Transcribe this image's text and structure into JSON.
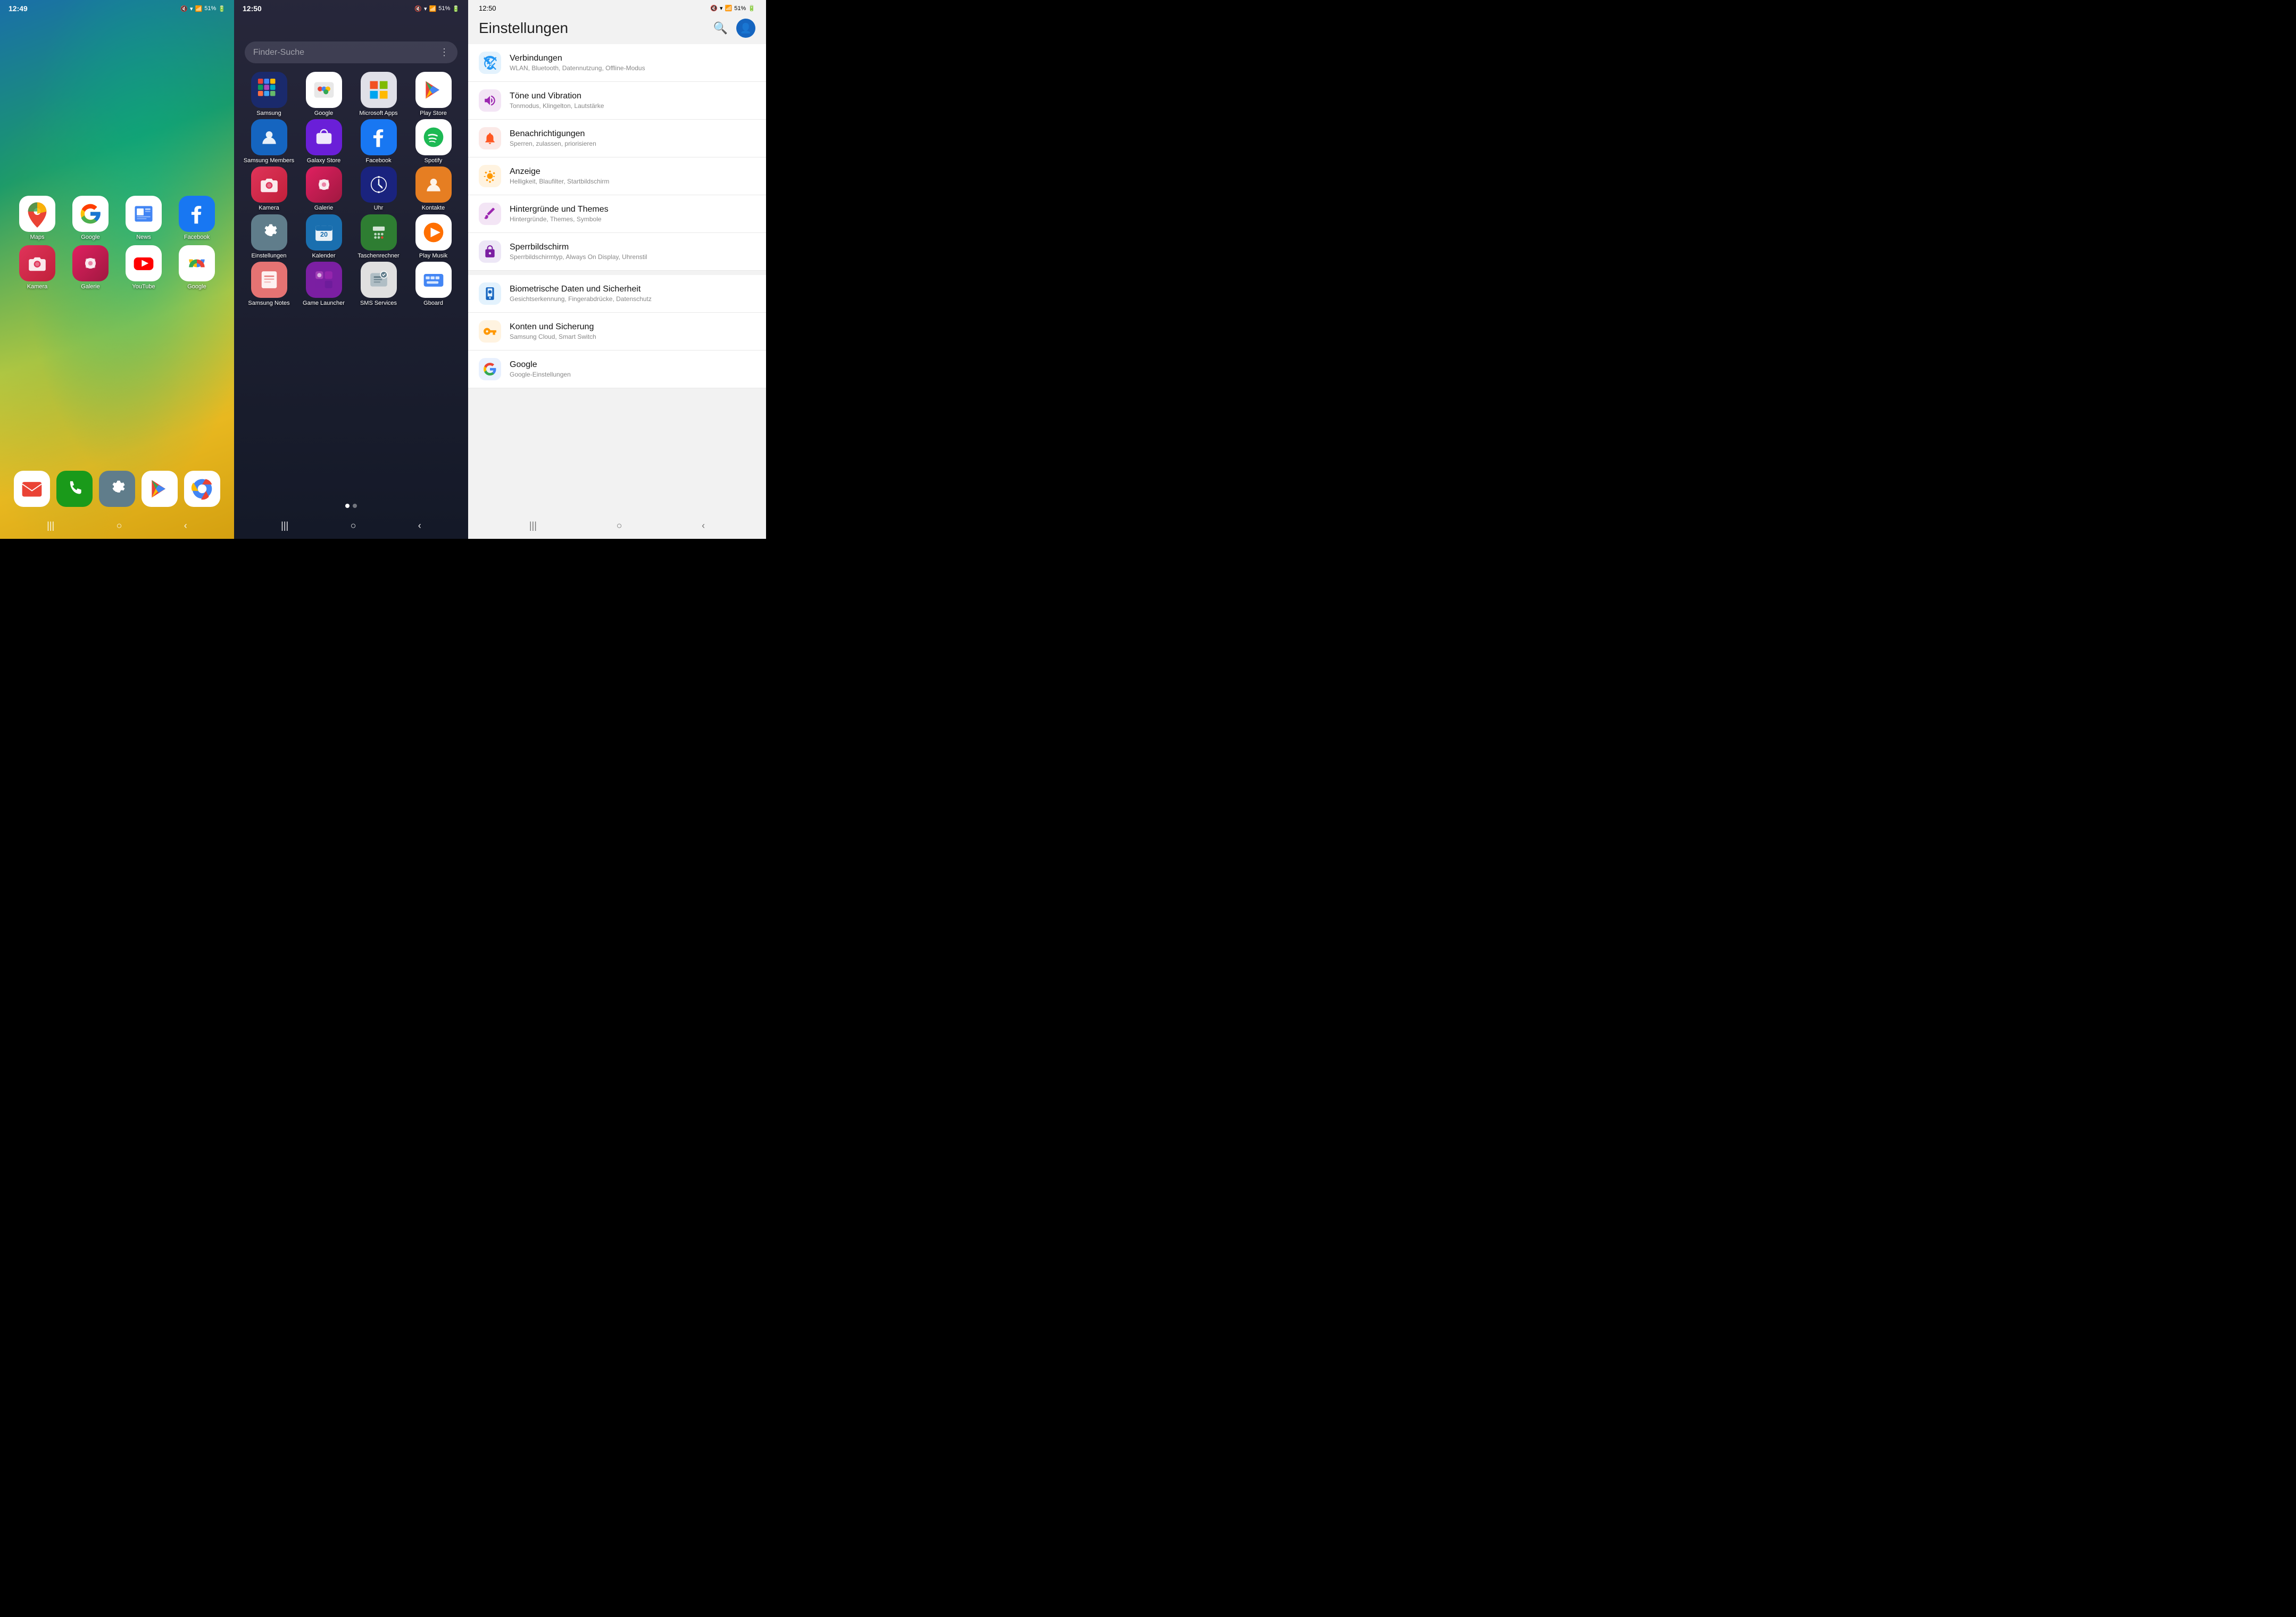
{
  "panel1": {
    "time": "12:49",
    "status": "51%",
    "apps_row1": [
      {
        "id": "maps",
        "label": "Maps",
        "icon": "maps"
      },
      {
        "id": "google",
        "label": "Google",
        "icon": "google"
      },
      {
        "id": "news",
        "label": "News",
        "icon": "news"
      },
      {
        "id": "facebook",
        "label": "Facebook",
        "icon": "facebook-home"
      }
    ],
    "apps_row2": [
      {
        "id": "kamera",
        "label": "Kamera",
        "icon": "kamera"
      },
      {
        "id": "galerie",
        "label": "Galerie",
        "icon": "galerie"
      },
      {
        "id": "youtube",
        "label": "YouTube",
        "icon": "youtube"
      },
      {
        "id": "google-photos",
        "label": "Google",
        "icon": "google-photos"
      }
    ],
    "dock": [
      {
        "id": "mail",
        "label": "",
        "icon": "mail"
      },
      {
        "id": "phone",
        "label": "",
        "icon": "phone"
      },
      {
        "id": "settings-dock",
        "label": "",
        "icon": "einstellungen-dock"
      },
      {
        "id": "playstore-dock",
        "label": "",
        "icon": "playstore-dock"
      },
      {
        "id": "chrome",
        "label": "",
        "icon": "chrome"
      }
    ],
    "nav": [
      "|||",
      "○",
      "‹"
    ]
  },
  "panel2": {
    "time": "12:50",
    "status": "51%",
    "search_placeholder": "Finder-Suche",
    "apps": [
      {
        "id": "samsung",
        "label": "Samsung",
        "icon": "samsung"
      },
      {
        "id": "google-folder",
        "label": "Google",
        "icon": "google-folder"
      },
      {
        "id": "ms-apps",
        "label": "Microsoft Apps",
        "icon": "ms-apps"
      },
      {
        "id": "playstore",
        "label": "Play Store",
        "icon": "playstore"
      },
      {
        "id": "samsung-members",
        "label": "Samsung Members",
        "icon": "samsung-members"
      },
      {
        "id": "galaxy-store",
        "label": "Galaxy Store",
        "icon": "galaxy-store"
      },
      {
        "id": "facebook-drawer",
        "label": "Facebook",
        "icon": "facebook-drawer"
      },
      {
        "id": "spotify",
        "label": "Spotify",
        "icon": "spotify"
      },
      {
        "id": "kamera-drawer",
        "label": "Kamera",
        "icon": "kamera-drawer"
      },
      {
        "id": "galerie-drawer",
        "label": "Galerie",
        "icon": "galerie-drawer"
      },
      {
        "id": "uhr",
        "label": "Uhr",
        "icon": "uhr"
      },
      {
        "id": "kontakte",
        "label": "Kontakte",
        "icon": "kontakte"
      },
      {
        "id": "einstellungen-drawer",
        "label": "Einstellungen",
        "icon": "einstellungen-drawer"
      },
      {
        "id": "kalender",
        "label": "Kalender",
        "icon": "kalender"
      },
      {
        "id": "taschenrechner",
        "label": "Taschenrechner",
        "icon": "taschenrechner"
      },
      {
        "id": "playmusik",
        "label": "Play Musik",
        "icon": "playmusik"
      },
      {
        "id": "samsung-notes",
        "label": "Samsung Notes",
        "icon": "samsung-notes"
      },
      {
        "id": "game-launcher",
        "label": "Game Launcher",
        "icon": "game-launcher"
      },
      {
        "id": "sms-services",
        "label": "SMS Services",
        "icon": "sms-services"
      },
      {
        "id": "gboard",
        "label": "Gboard",
        "icon": "gboard"
      }
    ],
    "page_dots": [
      true,
      false
    ],
    "nav": [
      "|||",
      "○",
      "‹"
    ]
  },
  "panel3": {
    "time": "12:50",
    "status": "51%",
    "title": "Einstellungen",
    "items": [
      {
        "id": "verbindungen",
        "icon": "wifi",
        "icon_color": "#2196F3",
        "icon_bg": "#E3F2FD",
        "title": "Verbindungen",
        "subtitle": "WLAN, Bluetooth, Datennutzung, Offline-Modus"
      },
      {
        "id": "toene",
        "icon": "volume",
        "icon_color": "#9C27B0",
        "icon_bg": "#F3E5F5",
        "title": "Töne und Vibration",
        "subtitle": "Tonmodus, Klingelton, Lautstärke"
      },
      {
        "id": "benachrichtigungen",
        "icon": "bell",
        "icon_color": "#FF5722",
        "icon_bg": "#FBE9E7",
        "title": "Benachrichtigungen",
        "subtitle": "Sperren, zulassen, priorisieren"
      },
      {
        "id": "anzeige",
        "icon": "sun",
        "icon_color": "#FF9800",
        "icon_bg": "#FFF3E0",
        "title": "Anzeige",
        "subtitle": "Helligkeit, Blaufilter, Startbildschirm"
      },
      {
        "id": "hintergruende",
        "icon": "brush",
        "icon_color": "#9C27B0",
        "icon_bg": "#F3E5F5",
        "title": "Hintergründe und Themes",
        "subtitle": "Hintergründe, Themes, Symbole"
      },
      {
        "id": "sperrbildschirm",
        "icon": "lock",
        "icon_color": "#9C27B0",
        "icon_bg": "#F3E5F5",
        "title": "Sperrbildschirm",
        "subtitle": "Sperrbildschirmtyp, Always On Display, Uhrenstil"
      },
      {
        "id": "biometrie",
        "icon": "shield",
        "icon_color": "#1565C0",
        "icon_bg": "#E3F2FD",
        "title": "Biometrische Daten und Sicherheit",
        "subtitle": "Gesichtserkennung, Fingerabdrücke, Datenschutz"
      },
      {
        "id": "konten",
        "icon": "key",
        "icon_color": "#FF9800",
        "icon_bg": "#FFF3E0",
        "title": "Konten und Sicherung",
        "subtitle": "Samsung Cloud, Smart Switch"
      },
      {
        "id": "google-settings",
        "icon": "google-g",
        "icon_color": "#4285F4",
        "icon_bg": "#E8F0FE",
        "title": "Google",
        "subtitle": "Google-Einstellungen"
      }
    ],
    "nav": [
      "|||",
      "○",
      "‹"
    ]
  }
}
